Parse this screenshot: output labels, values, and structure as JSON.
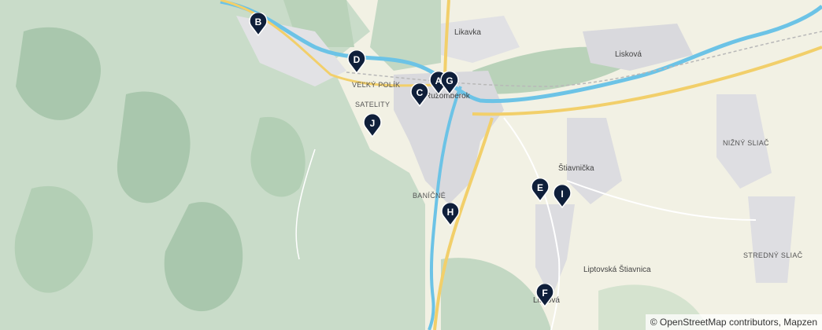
{
  "map": {
    "place_labels": [
      {
        "text": "Likavka",
        "kind": "town"
      },
      {
        "text": "Lisková",
        "kind": "town"
      },
      {
        "text": "VEĽKÝ POLÍK",
        "kind": "district"
      },
      {
        "text": "SATELITY",
        "kind": "district"
      },
      {
        "text": "Ružomberok",
        "kind": "town"
      },
      {
        "text": "NIŽNÝ SLIAČ",
        "kind": "district"
      },
      {
        "text": "Štiavnička",
        "kind": "town"
      },
      {
        "text": "BANÍČNÉ",
        "kind": "district"
      },
      {
        "text": "STREDNÝ SLIAČ",
        "kind": "district"
      },
      {
        "text": "Liptovská Štiavnica",
        "kind": "town"
      },
      {
        "text": "Lisková",
        "kind": "town"
      }
    ],
    "markers": [
      {
        "label": "B"
      },
      {
        "label": "D"
      },
      {
        "label": "A"
      },
      {
        "label": "G"
      },
      {
        "label": "C"
      },
      {
        "label": "J"
      },
      {
        "label": "E"
      },
      {
        "label": "I"
      },
      {
        "label": "H"
      },
      {
        "label": "F"
      }
    ],
    "marker_color": "#0f1f3a",
    "attribution": "© OpenStreetMap contributors, Mapzen"
  }
}
